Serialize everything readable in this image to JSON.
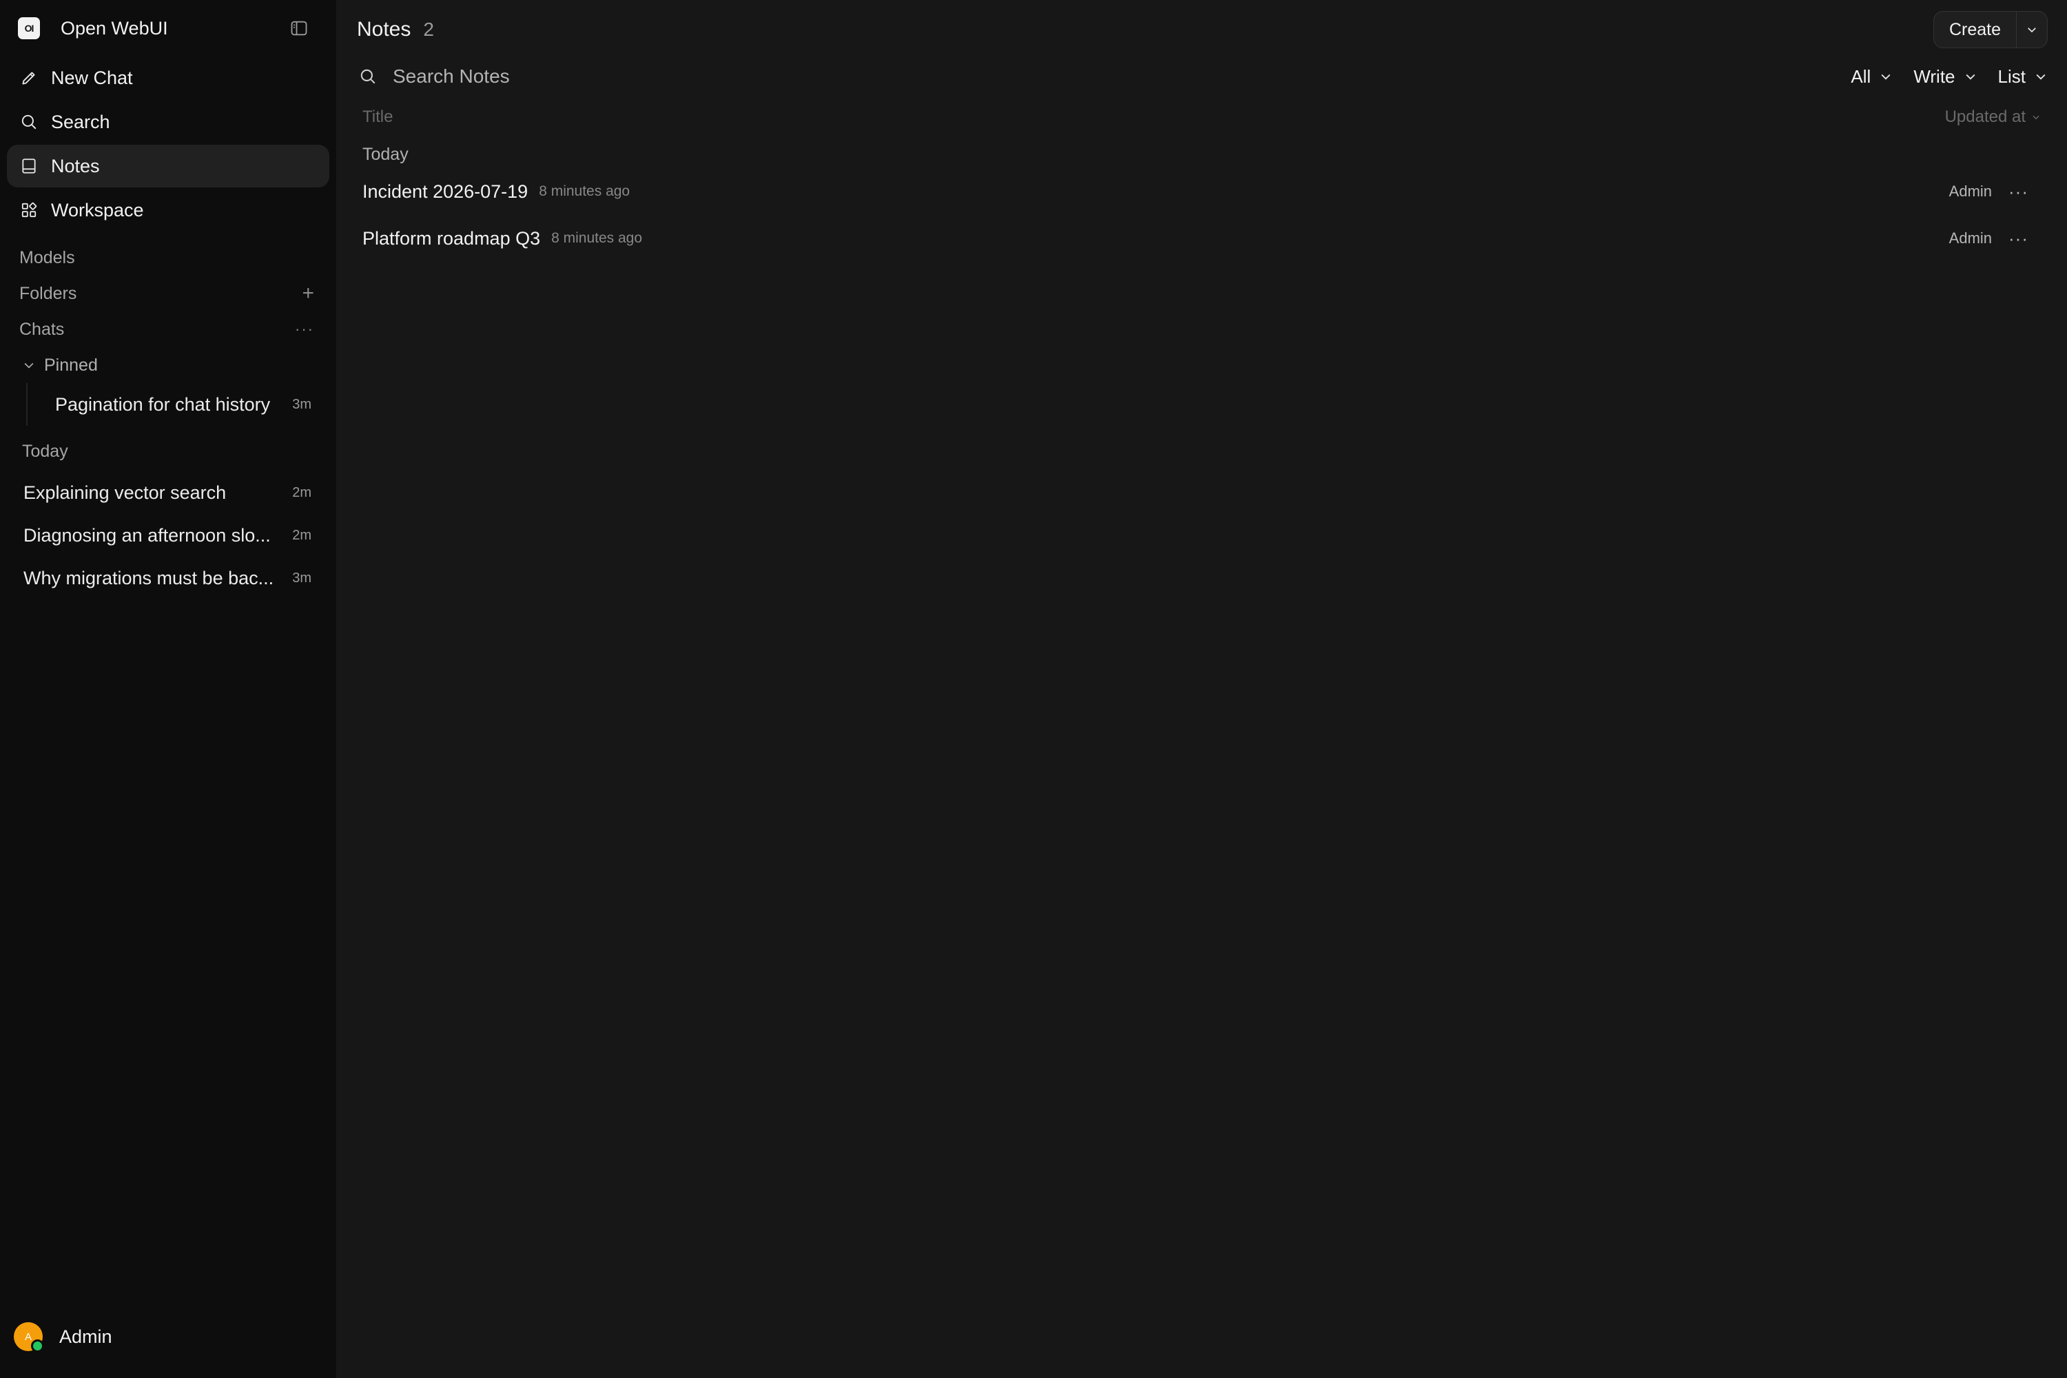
{
  "sidebar": {
    "logo_text": "OI",
    "app_name": "Open WebUI",
    "nav": [
      {
        "label": "New Chat",
        "icon": "pencil-icon"
      },
      {
        "label": "Search",
        "icon": "search-icon"
      },
      {
        "label": "Notes",
        "icon": "notebook-icon",
        "active": true
      },
      {
        "label": "Workspace",
        "icon": "grid-icon"
      }
    ],
    "sections": {
      "models": "Models",
      "folders": "Folders",
      "folders_action": "+",
      "chats": "Chats",
      "chats_action": "···"
    },
    "pinned": {
      "label": "Pinned",
      "items": [
        {
          "title": "Pagination for chat history",
          "age": "3m"
        }
      ]
    },
    "today": {
      "label": "Today",
      "items": [
        {
          "title": "Explaining vector search",
          "age": "2m"
        },
        {
          "title": "Diagnosing an afternoon slo...",
          "age": "2m"
        },
        {
          "title": "Why migrations must be bac...",
          "age": "3m"
        }
      ]
    },
    "user": {
      "initial": "A",
      "name": "Admin"
    }
  },
  "main": {
    "title": "Notes",
    "count": "2",
    "create_label": "Create",
    "search_placeholder": "Search Notes",
    "filters": [
      {
        "label": "All"
      },
      {
        "label": "Write"
      },
      {
        "label": "List"
      }
    ],
    "columns": {
      "title": "Title",
      "updated": "Updated at"
    },
    "group_label": "Today",
    "notes": [
      {
        "title": "Incident 2026-07-19",
        "time": "8 minutes ago",
        "owner": "Admin",
        "menu": "···"
      },
      {
        "title": "Platform roadmap Q3",
        "time": "8 minutes ago",
        "owner": "Admin",
        "menu": "···"
      }
    ]
  },
  "colors": {
    "background": "#171717",
    "sidebar_bg": "#0d0d0d",
    "active_item": "#212121",
    "avatar": "#f59e0b",
    "online": "#22c55e"
  }
}
